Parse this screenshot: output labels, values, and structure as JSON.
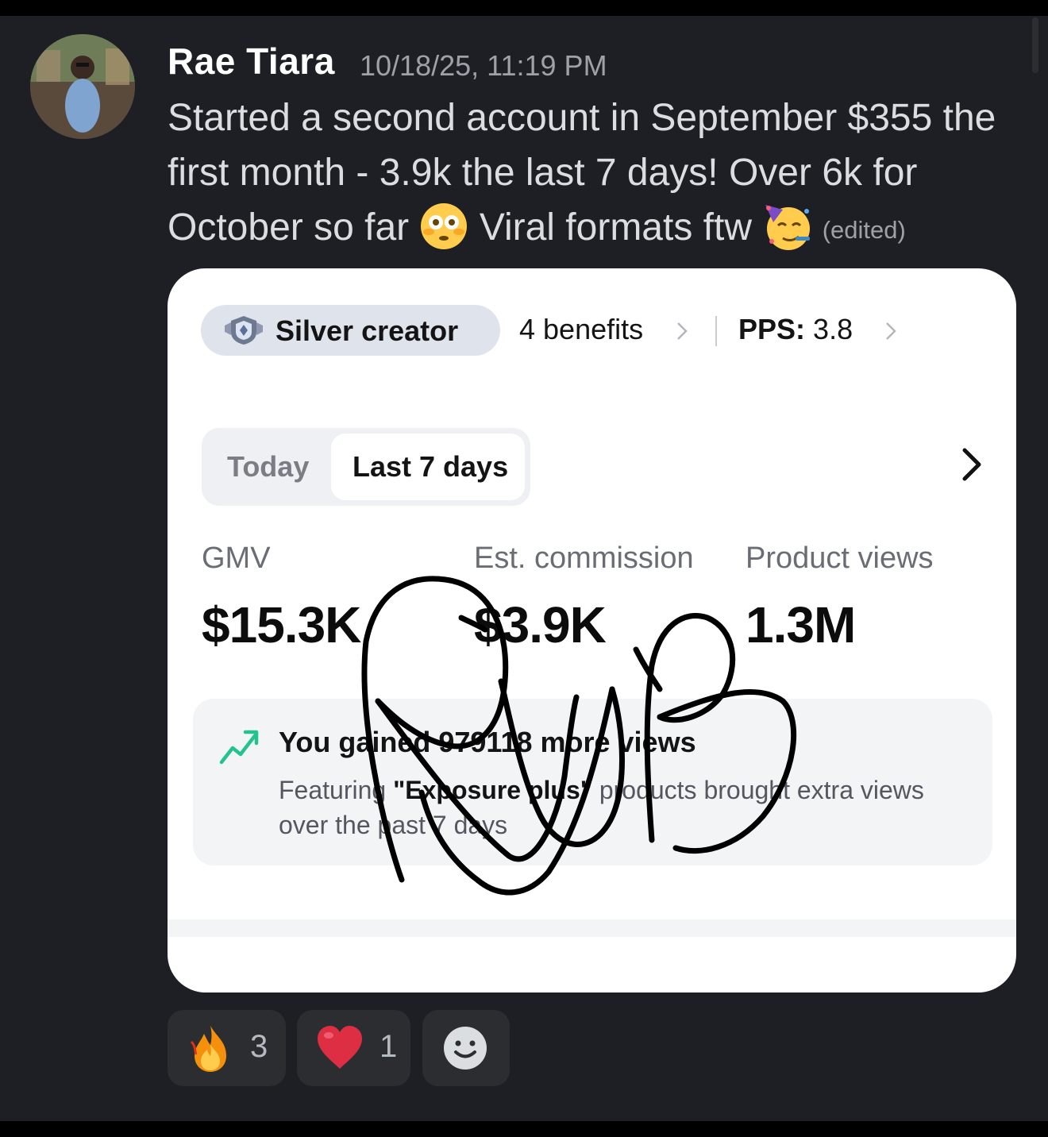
{
  "message": {
    "author": "Rae Tiara",
    "timestamp": "10/18/25, 11:19 PM",
    "text_part1": "Started a second account in September $355 the first month - 3.9k the last 7 days! Over 6k for October so far",
    "text_part2": "Viral formats ftw",
    "emoji_1": "flushed-face-emoji",
    "emoji_2": "partying-face-emoji",
    "edited_label": "(edited)"
  },
  "attachment": {
    "tier_label": "Silver creator",
    "benefits_label": "4 benefits",
    "pps_label": "PPS:",
    "pps_value": "3.8",
    "tabs": {
      "today": "Today",
      "last7": "Last 7 days",
      "active": "last7"
    },
    "stats": [
      {
        "label": "GMV",
        "value": "$15.3K"
      },
      {
        "label": "Est. commission",
        "value": "$3.9K"
      },
      {
        "label": "Product views",
        "value": "1.3M"
      }
    ],
    "info": {
      "title": "You gained 979118 more views",
      "text_prefix": "Featuring",
      "text_bold": "\"Exposure plus\"",
      "text_suffix": "products brought extra views over the past 7 days"
    }
  },
  "reactions": [
    {
      "emoji": "fire-emoji",
      "count": "3"
    },
    {
      "emoji": "red-heart-emoji",
      "count": "1"
    }
  ],
  "colors": {
    "background": "#1e1f24",
    "reaction_bg": "#2b2d31",
    "trend_green": "#22c38e"
  }
}
